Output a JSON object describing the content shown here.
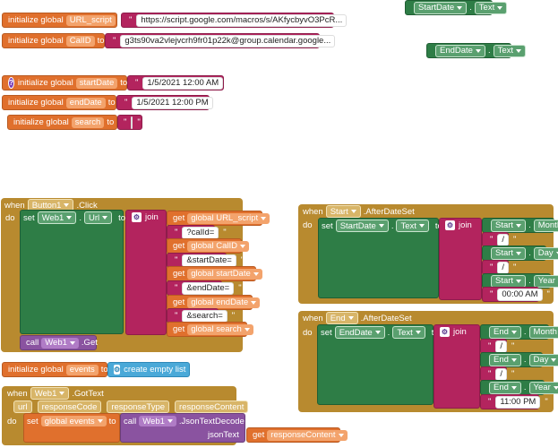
{
  "globals": {
    "url_script": {
      "keyword": "initialize global",
      "name": "URL_script",
      "to": "to",
      "value": "https://script.google.com/macros/s/AKfycbyvO3PcR..."
    },
    "calid": {
      "keyword": "initialize global",
      "name": "CalID",
      "to": "to",
      "value": "g3ts90va2vlejvcrh9fr01p22k@group.calendar.google..."
    },
    "startdate": {
      "keyword": "initialize global",
      "name": "startDate",
      "to": "to",
      "value": "1/5/2021 12:00 AM"
    },
    "enddate": {
      "keyword": "initialize global",
      "name": "endDate",
      "to": "to",
      "value": "1/5/2021 12:00 PM"
    },
    "search": {
      "keyword": "initialize global",
      "name": "search",
      "to": "to",
      "value": ""
    },
    "events": {
      "keyword": "initialize global",
      "name": "events",
      "to": "to",
      "value": "create empty list"
    }
  },
  "floating": {
    "startdate_text": {
      "component": "StartDate",
      "prop": "Text"
    },
    "enddate_text": {
      "component": "EndDate",
      "prop": "Text"
    }
  },
  "button1_click": {
    "when": "when",
    "component": "Button1",
    "event": ".Click",
    "do": "do",
    "set": "set",
    "target": "Web1",
    "prop": "Url",
    "to": "to",
    "join": "join",
    "items": [
      {
        "kind": "get",
        "label": "get",
        "value": "global URL_script"
      },
      {
        "kind": "text",
        "value": "?calId="
      },
      {
        "kind": "get",
        "label": "get",
        "value": "global CalID"
      },
      {
        "kind": "text",
        "value": "&startDate="
      },
      {
        "kind": "get",
        "label": "get",
        "value": "global startDate"
      },
      {
        "kind": "text",
        "value": "&endDate="
      },
      {
        "kind": "get",
        "label": "get",
        "value": "global endDate"
      },
      {
        "kind": "text",
        "value": "&search="
      },
      {
        "kind": "get",
        "label": "get",
        "value": "global search"
      }
    ],
    "call": "call",
    "call_component": "Web1",
    "call_method": ".Get"
  },
  "start_after": {
    "when": "when",
    "component": "Start",
    "event": ".AfterDateSet",
    "do": "do",
    "set": "set",
    "target": "StartDate",
    "prop": "Text",
    "to": "to",
    "join": "join",
    "rows": [
      {
        "comp": "Start",
        "prop": "Month"
      },
      {
        "sep": "/"
      },
      {
        "comp": "Start",
        "prop": "Day"
      },
      {
        "sep": "/"
      },
      {
        "comp": "Start",
        "prop": "Year"
      },
      {
        "text": "00:00 AM"
      }
    ]
  },
  "end_after": {
    "when": "when",
    "component": "End",
    "event": ".AfterDateSet",
    "do": "do",
    "set": "set",
    "target": "EndDate",
    "prop": "Text",
    "to": "to",
    "join": "join",
    "rows": [
      {
        "comp": "End",
        "prop": "Month"
      },
      {
        "sep": "/"
      },
      {
        "comp": "End",
        "prop": "Day"
      },
      {
        "sep": "/"
      },
      {
        "comp": "End",
        "prop": "Year"
      },
      {
        "text": "11:00 PM"
      }
    ]
  },
  "web1_gottext": {
    "when": "when",
    "component": "Web1",
    "event": ".GotText",
    "params": [
      "url",
      "responseCode",
      "responseType",
      "responseContent"
    ],
    "do": "do",
    "set": "set",
    "target": "global events",
    "to": "to",
    "call": "call",
    "call_component": "Web1",
    "call_method": ".JsonTextDecode",
    "arg": "jsonText",
    "get": "get",
    "get_value": "responseContent"
  },
  "colors": {
    "variable": "#e0702d",
    "text": "#b3245e",
    "component": "#2e7d46",
    "control": "#b88a2f",
    "procedure": "#8a53a0",
    "list": "#4aa9d8"
  }
}
